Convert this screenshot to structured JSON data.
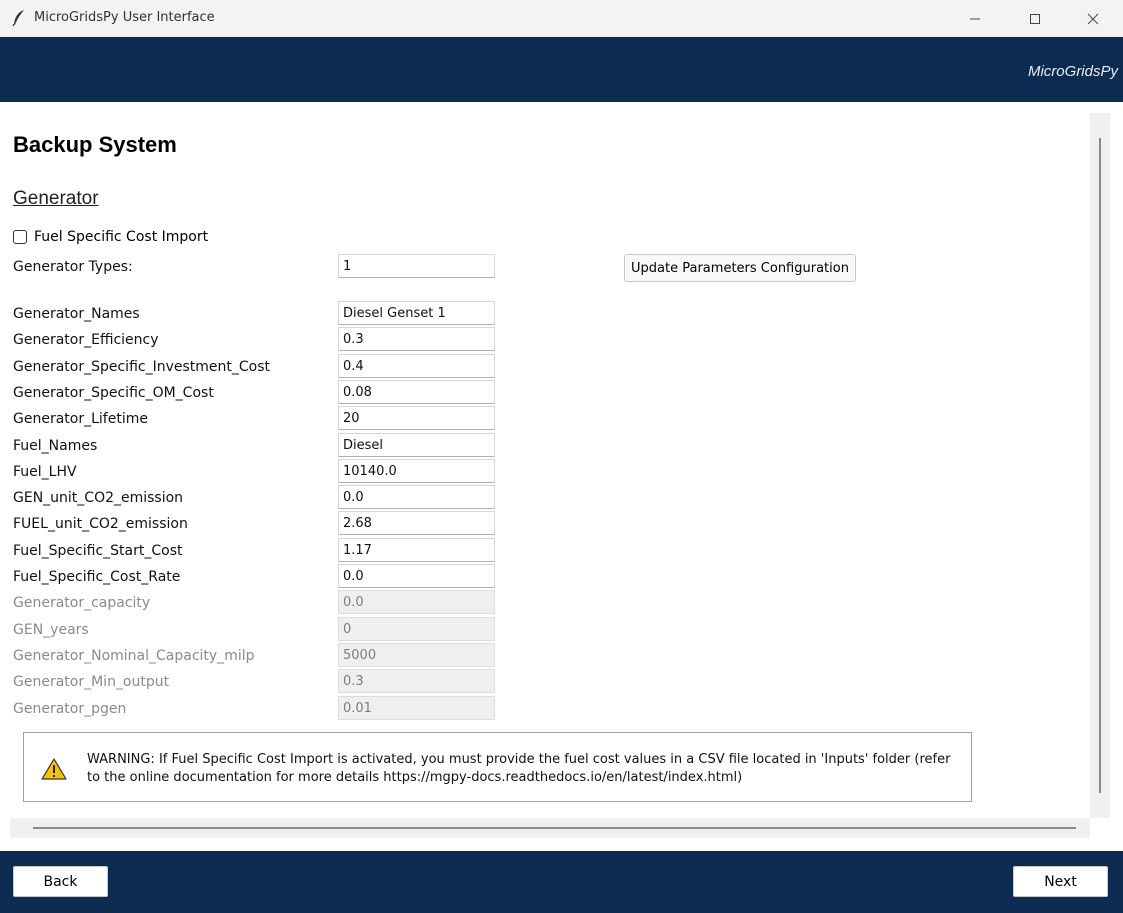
{
  "window": {
    "title": "MicroGridsPy User Interface",
    "app_icon": "feather-icon",
    "controls": [
      "minimize-icon",
      "maximize-icon",
      "close-icon"
    ]
  },
  "header": {
    "brand": "MicroGridsPy"
  },
  "page": {
    "title": "Backup System",
    "section": "Generator",
    "checkbox_label": "Fuel Specific Cost Import",
    "checkbox_checked": false,
    "generator_types_label": "Generator Types:",
    "generator_types_value": "1",
    "update_button": "Update Parameters Configuration"
  },
  "params": [
    {
      "label": "Generator_Names",
      "value": "Diesel Genset 1",
      "enabled": true
    },
    {
      "label": "Generator_Efficiency",
      "value": "0.3",
      "enabled": true
    },
    {
      "label": "Generator_Specific_Investment_Cost",
      "value": "0.4",
      "enabled": true
    },
    {
      "label": "Generator_Specific_OM_Cost",
      "value": "0.08",
      "enabled": true
    },
    {
      "label": "Generator_Lifetime",
      "value": "20",
      "enabled": true
    },
    {
      "label": "Fuel_Names",
      "value": "Diesel",
      "enabled": true
    },
    {
      "label": "Fuel_LHV",
      "value": "10140.0",
      "enabled": true
    },
    {
      "label": "GEN_unit_CO2_emission",
      "value": "0.0",
      "enabled": true
    },
    {
      "label": "FUEL_unit_CO2_emission",
      "value": "2.68",
      "enabled": true
    },
    {
      "label": "Fuel_Specific_Start_Cost",
      "value": "1.17",
      "enabled": true
    },
    {
      "label": "Fuel_Specific_Cost_Rate",
      "value": "0.0",
      "enabled": true
    },
    {
      "label": "Generator_capacity",
      "value": "0.0",
      "enabled": false
    },
    {
      "label": "GEN_years",
      "value": "0",
      "enabled": false
    },
    {
      "label": "Generator_Nominal_Capacity_milp",
      "value": "5000",
      "enabled": false
    },
    {
      "label": "Generator_Min_output",
      "value": "0.3",
      "enabled": false
    },
    {
      "label": "Generator_pgen",
      "value": "0.01",
      "enabled": false
    }
  ],
  "warning": {
    "icon": "warning-icon",
    "text": "WARNING: If Fuel Specific Cost Import is activated, you must provide the fuel cost values in a CSV file located in 'Inputs' folder (refer to the online documentation for more details https://mgpy-docs.readthedocs.io/en/latest/index.html)"
  },
  "footer": {
    "back": "Back",
    "next": "Next"
  },
  "colors": {
    "header_bg": "#0d2a50",
    "warning_yellow": "#f5c400"
  }
}
